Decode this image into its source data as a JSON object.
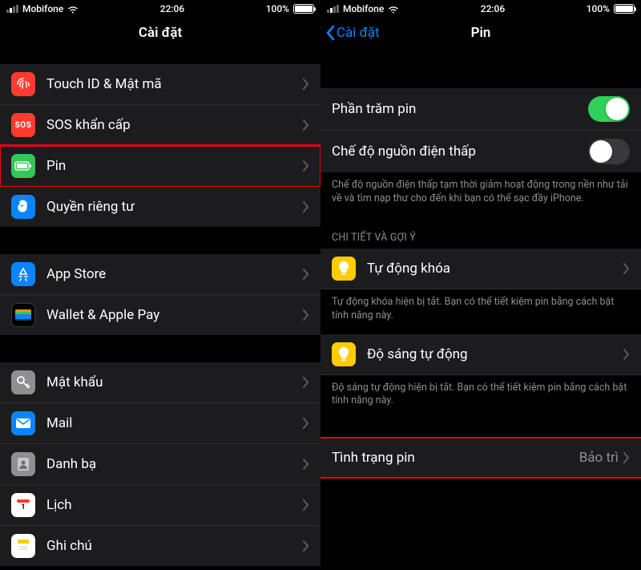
{
  "status": {
    "carrier": "Mobifone",
    "time": "22:06",
    "battery_pct": "100%"
  },
  "left": {
    "title": "Cài đặt",
    "groups": [
      {
        "rows": [
          {
            "id": "touchid",
            "label": "Touch ID & Mật mã",
            "icon_bg": "#ff3b30",
            "icon": "fingerprint"
          },
          {
            "id": "sos",
            "label": "SOS khẩn cấp",
            "icon_bg": "#ff3b30",
            "icon": "sos",
            "icon_text": "SOS"
          },
          {
            "id": "battery",
            "label": "Pin",
            "icon_bg": "#34c759",
            "icon": "battery",
            "highlight": true
          },
          {
            "id": "privacy",
            "label": "Quyền riêng tư",
            "icon_bg": "#0a84ff",
            "icon": "hand"
          }
        ]
      },
      {
        "rows": [
          {
            "id": "appstore",
            "label": "App Store",
            "icon_bg": "#0a84ff",
            "icon": "appstore"
          },
          {
            "id": "wallet",
            "label": "Wallet & Apple Pay",
            "icon_bg": "#000000",
            "icon": "wallet"
          }
        ]
      },
      {
        "rows": [
          {
            "id": "passwords",
            "label": "Mật khẩu",
            "icon_bg": "#8e8e93",
            "icon": "key"
          },
          {
            "id": "mail",
            "label": "Mail",
            "icon_bg": "#0a84ff",
            "icon": "mail"
          },
          {
            "id": "contacts",
            "label": "Danh bạ",
            "icon_bg": "#8e8e93",
            "icon": "contacts"
          },
          {
            "id": "calendar",
            "label": "Lịch",
            "icon_bg": "#ffffff",
            "icon": "calendar"
          },
          {
            "id": "notes",
            "label": "Ghi chú",
            "icon_bg": "#ffffff",
            "icon": "notes"
          }
        ]
      }
    ]
  },
  "right": {
    "back_label": "Cài đặt",
    "title": "Pin",
    "percent_row": {
      "label": "Phần trăm pin",
      "on": true
    },
    "lowpower_row": {
      "label": "Chế độ nguồn điện thấp",
      "on": false
    },
    "lowpower_note": "Chế độ nguồn điện thấp tạm thời giảm hoạt động trong nền như tải về và tìm nạp thư cho đến khi bạn có thể sạc đầy iPhone.",
    "sugg_header": "CHI TIẾT VÀ GỢI Ý",
    "sugg1": {
      "label": "Tự động khóa",
      "note": "Tự động khóa hiện bị tắt. Bạn có thể tiết kiệm pin bằng cách bật tính năng này."
    },
    "sugg2": {
      "label": "Độ sáng tự động",
      "note": "Độ sáng tự động hiện bị tắt. Bạn có thể tiết kiệm pin bằng cách bật tính năng này."
    },
    "health_row": {
      "label": "Tình trạng pin",
      "value": "Bảo trì",
      "highlight": true
    }
  }
}
